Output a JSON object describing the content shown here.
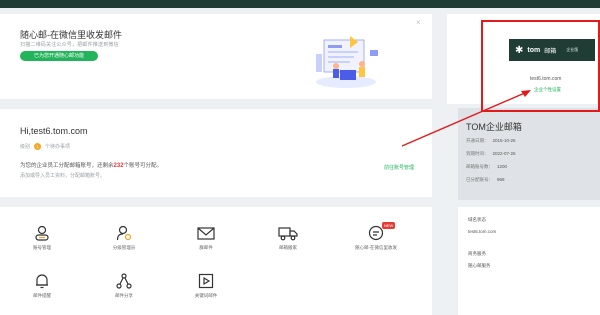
{
  "promo": {
    "title": "随心邮-在微信里收发邮件",
    "subtitle": "扫描二维码关注公众号，把邮件推送到微信",
    "button": "已为您开通随心邮功能",
    "close": "×"
  },
  "account": {
    "greeting": "Hi,test6.tom.com",
    "meta_prefix": "级别",
    "meta_badge": "1",
    "meta_suffix": "个待办事项",
    "line1_prefix": "为您的企业员工分配邮箱账号，还剩余",
    "line1_count": "232",
    "line1_suffix": "个账号可分配。",
    "line2": "添加或导入员工资料，分配邮箱账号。",
    "manage_link": "前往账号管理"
  },
  "tools": [
    {
      "label": "账号管理",
      "icon": "user-icon"
    },
    {
      "label": "分级管理员",
      "icon": "admin-gear-icon"
    },
    {
      "label": "群邮件",
      "icon": "mail-icon"
    },
    {
      "label": "邮箱搬家",
      "icon": "truck-icon"
    },
    {
      "label": "随心邮-在微信里收发",
      "icon": "wechat-icon",
      "badge": "NEW"
    },
    {
      "label": "邮件提醒",
      "icon": "bell-icon"
    },
    {
      "label": "邮件分享",
      "icon": "share-icon"
    },
    {
      "label": "关键词邮件",
      "icon": "play-box-icon"
    }
  ],
  "brand": {
    "logo_mark": "✱",
    "logo_name": "tom",
    "logo_cn": "邮箱",
    "logo_tag": "企业版",
    "domain": "test6.tom.com",
    "link": "企业个性设置"
  },
  "info": {
    "title": "TOM企业邮箱",
    "rows": [
      {
        "k": "开通日期：",
        "v": "2015-10-26"
      },
      {
        "k": "到期时间：",
        "v": "2022-07-26"
      },
      {
        "k": "邮箱账号数：",
        "v": "1200"
      },
      {
        "k": "已分配账号：",
        "v": "968"
      }
    ]
  },
  "contact": {
    "label1": "域名状态",
    "value1": "test6.tom.com",
    "label2": "商务服务",
    "value2": "随心邮服务"
  },
  "colors": {
    "accent": "#21b45a",
    "dark": "#1f3d35",
    "alert": "#e21a1a"
  }
}
